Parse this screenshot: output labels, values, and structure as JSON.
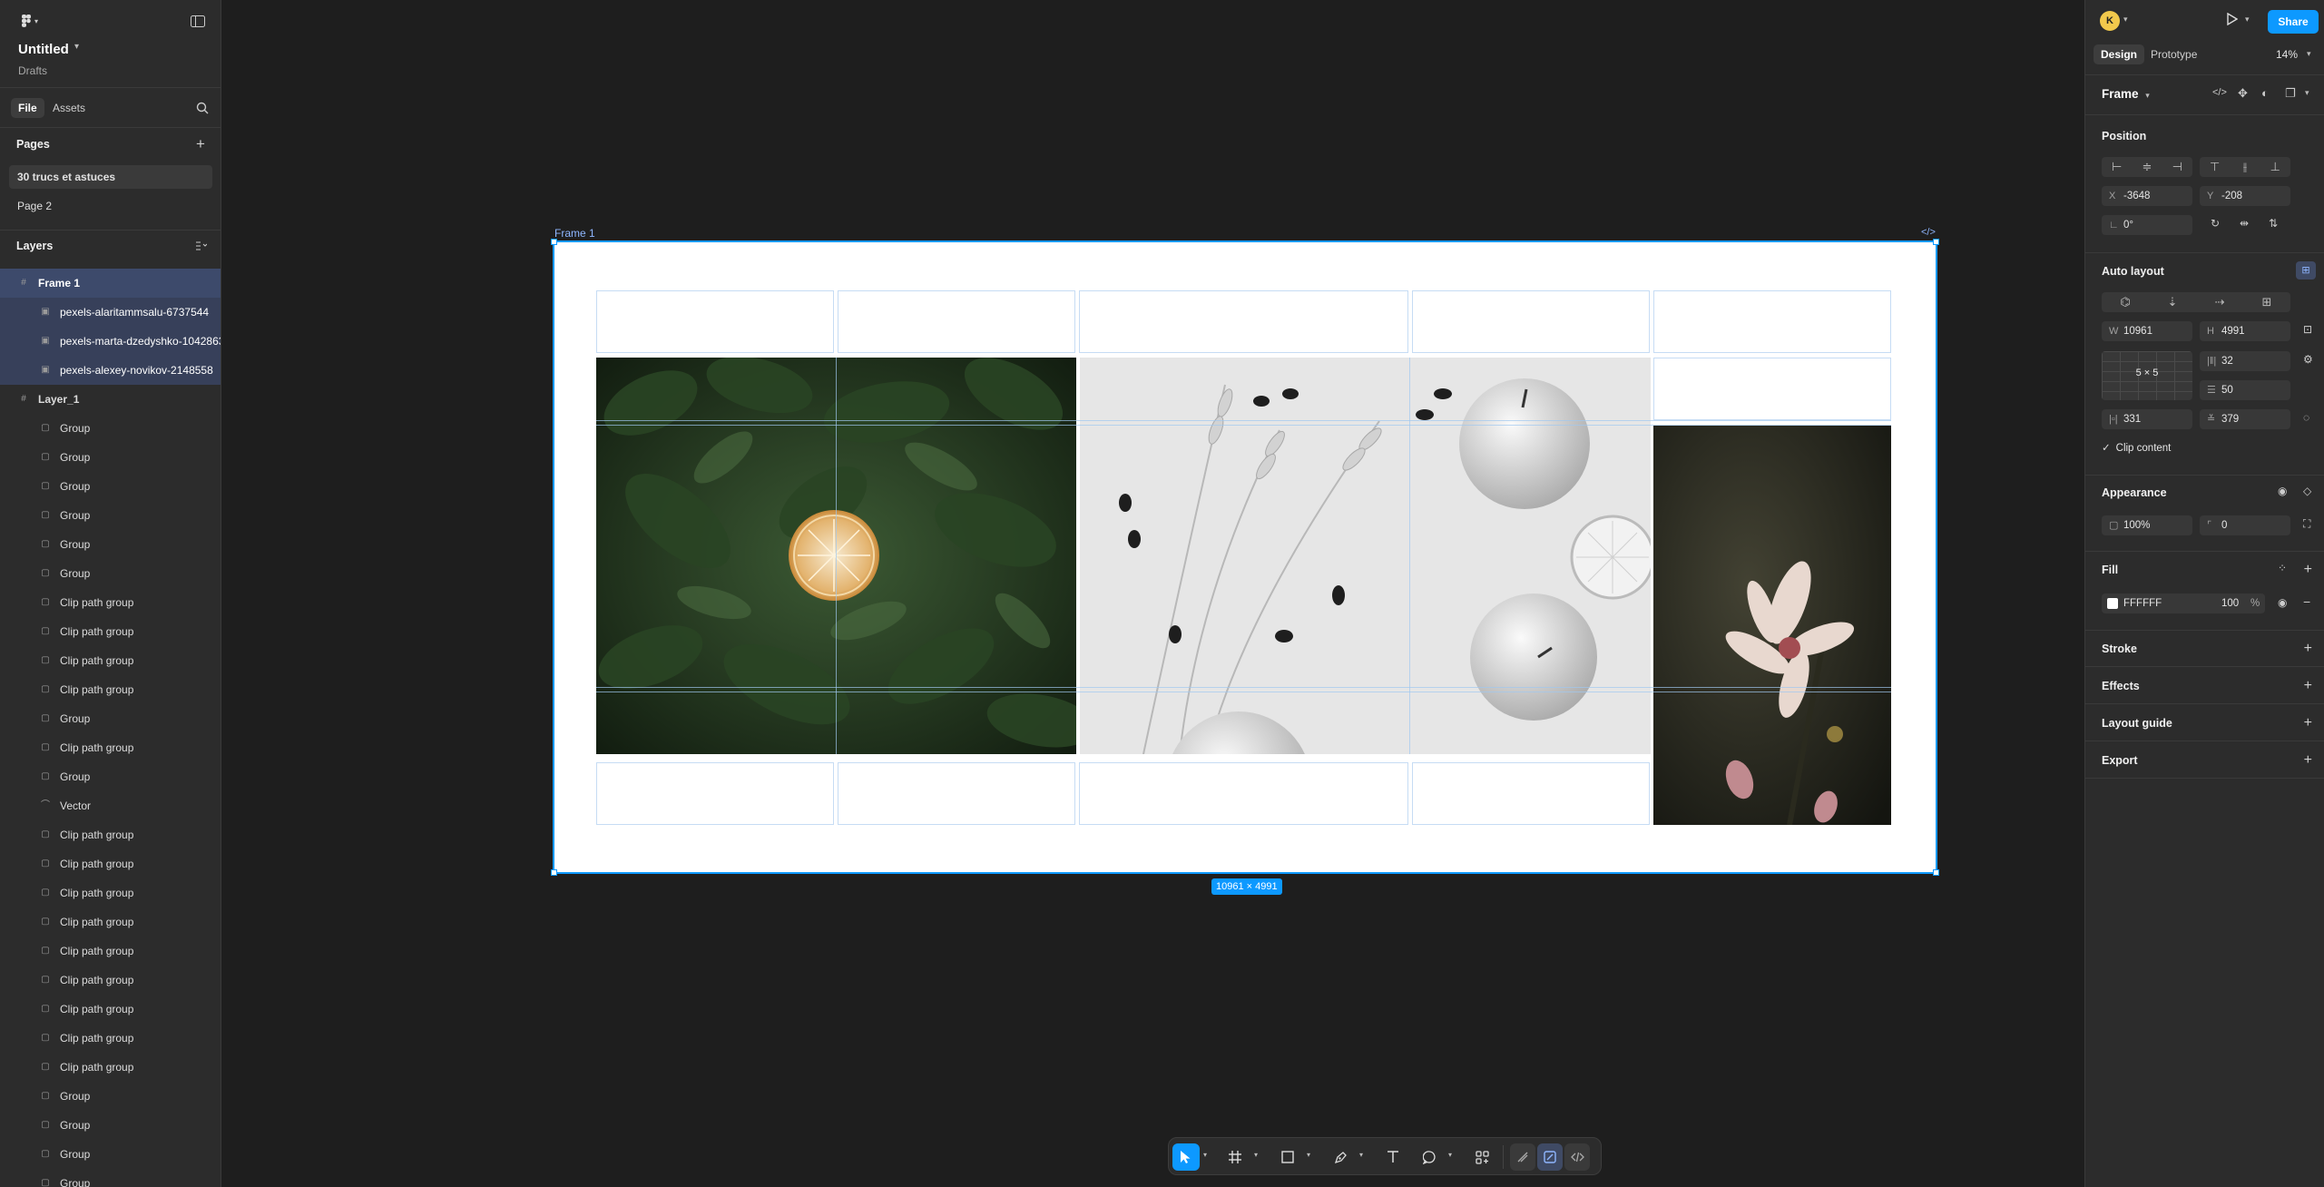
{
  "app": {
    "file_title": "Untitled",
    "file_location": "Drafts"
  },
  "left_tabs": {
    "file": "File",
    "assets": "Assets"
  },
  "pages": {
    "heading": "Pages",
    "items": [
      "30 trucs et astuces",
      "Page 2"
    ]
  },
  "layers": {
    "heading": "Layers",
    "items": [
      {
        "name": "Frame 1",
        "level": 0,
        "icon": "frame-icon",
        "state": "selected"
      },
      {
        "name": "pexels-alaritammsalu-6737544",
        "level": 1,
        "icon": "image-icon",
        "state": "selected-child"
      },
      {
        "name": "pexels-marta-dzedyshko-1042863",
        "level": 1,
        "icon": "image-icon",
        "state": "selected-child"
      },
      {
        "name": "pexels-alexey-novikov-2148558",
        "level": 1,
        "icon": "image-icon",
        "state": "selected-child"
      },
      {
        "name": "Layer_1",
        "level": 0,
        "icon": "frame-icon",
        "state": "normal"
      },
      {
        "name": "Group",
        "level": 1,
        "icon": "group-icon",
        "state": "normal"
      },
      {
        "name": "Group",
        "level": 1,
        "icon": "group-icon",
        "state": "normal"
      },
      {
        "name": "Group",
        "level": 1,
        "icon": "group-icon",
        "state": "normal"
      },
      {
        "name": "Group",
        "level": 1,
        "icon": "group-icon",
        "state": "normal"
      },
      {
        "name": "Group",
        "level": 1,
        "icon": "group-icon",
        "state": "normal"
      },
      {
        "name": "Group",
        "level": 1,
        "icon": "group-icon",
        "state": "normal"
      },
      {
        "name": "Clip path group",
        "level": 1,
        "icon": "group-icon",
        "state": "normal"
      },
      {
        "name": "Clip path group",
        "level": 1,
        "icon": "group-icon",
        "state": "normal"
      },
      {
        "name": "Clip path group",
        "level": 1,
        "icon": "group-icon",
        "state": "normal"
      },
      {
        "name": "Clip path group",
        "level": 1,
        "icon": "group-icon",
        "state": "normal"
      },
      {
        "name": "Group",
        "level": 1,
        "icon": "group-icon",
        "state": "normal"
      },
      {
        "name": "Clip path group",
        "level": 1,
        "icon": "group-icon",
        "state": "normal"
      },
      {
        "name": "Group",
        "level": 1,
        "icon": "group-icon",
        "state": "normal"
      },
      {
        "name": "Vector",
        "level": 1,
        "icon": "vector-icon",
        "state": "normal"
      },
      {
        "name": "Clip path group",
        "level": 1,
        "icon": "group-icon",
        "state": "normal"
      },
      {
        "name": "Clip path group",
        "level": 1,
        "icon": "group-icon",
        "state": "normal"
      },
      {
        "name": "Clip path group",
        "level": 1,
        "icon": "group-icon",
        "state": "normal"
      },
      {
        "name": "Clip path group",
        "level": 1,
        "icon": "group-icon",
        "state": "normal"
      },
      {
        "name": "Clip path group",
        "level": 1,
        "icon": "group-icon",
        "state": "normal"
      },
      {
        "name": "Clip path group",
        "level": 1,
        "icon": "group-icon",
        "state": "normal"
      },
      {
        "name": "Clip path group",
        "level": 1,
        "icon": "group-icon",
        "state": "normal"
      },
      {
        "name": "Clip path group",
        "level": 1,
        "icon": "group-icon",
        "state": "normal"
      },
      {
        "name": "Clip path group",
        "level": 1,
        "icon": "group-icon",
        "state": "normal"
      },
      {
        "name": "Group",
        "level": 1,
        "icon": "group-icon",
        "state": "normal"
      },
      {
        "name": "Group",
        "level": 1,
        "icon": "group-icon",
        "state": "normal"
      },
      {
        "name": "Group",
        "level": 1,
        "icon": "group-icon",
        "state": "normal"
      },
      {
        "name": "Group",
        "level": 1,
        "icon": "group-icon",
        "state": "normal"
      }
    ]
  },
  "canvas": {
    "frame_label": "Frame 1",
    "frame_code_glyph": "</>",
    "size_badge": "10961 × 4991",
    "photos": [
      "spinach-lemon",
      "wheat-apples",
      "magnolia"
    ]
  },
  "toolbar": {
    "tools": [
      "move",
      "frame",
      "rectangle",
      "pen",
      "text",
      "comment",
      "actions",
      "draw",
      "design",
      "dev"
    ],
    "active": "move"
  },
  "header_right": {
    "avatar_initial": "K",
    "share_label": "Share",
    "tab_design": "Design",
    "tab_prototype": "Prototype",
    "zoom": "14%"
  },
  "properties": {
    "layer_type": "Frame",
    "position": {
      "heading": "Position",
      "x_label": "X",
      "x": "-3648",
      "y_label": "Y",
      "y": "-208",
      "rotation": "0°"
    },
    "auto_layout": {
      "heading": "Auto layout",
      "w_label": "W",
      "w": "10961",
      "h_label": "H",
      "h": "4991",
      "grid": "5 × 5",
      "gap_h": "32",
      "gap_v": "50",
      "pad_h": "331",
      "pad_v": "379",
      "clip_content": "Clip content"
    },
    "appearance": {
      "heading": "Appearance",
      "opacity": "100%",
      "radius": "0"
    },
    "fill": {
      "heading": "Fill",
      "color_hex": "FFFFFF",
      "color": "#FFFFFF",
      "opacity": "100",
      "percent": "%"
    },
    "stroke": {
      "heading": "Stroke"
    },
    "effects": {
      "heading": "Effects"
    },
    "layout_guide": {
      "heading": "Layout guide"
    },
    "export": {
      "heading": "Export"
    }
  },
  "colors": {
    "accent": "#0d99ff",
    "panel": "#2c2c2c",
    "canvas": "#1e1e1e"
  }
}
